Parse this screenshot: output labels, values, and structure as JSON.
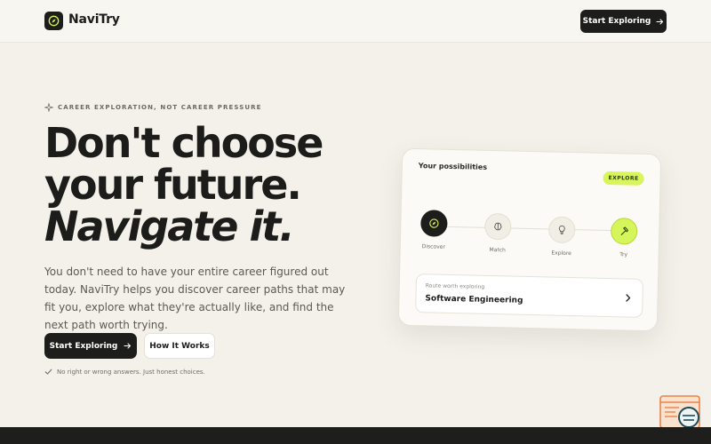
{
  "header": {
    "brand": "NaviTry",
    "cta_label": "Start Exploring"
  },
  "hero": {
    "eyebrow": "CAREER EXPLORATION, NOT CAREER PRESSURE",
    "headline_line1": "Don't choose",
    "headline_line2": "your future.",
    "headline_line3": "Navigate it.",
    "intro": "You don't need to have your entire career figured out today. NaviTry helps you discover career paths that may fit you, explore what they're actually like, and find the next path worth trying.",
    "primary_label": "Start Exploring",
    "secondary_label": "How It Works",
    "note": "No right or wrong answers. Just honest choices."
  },
  "card": {
    "title": "Your possibilities",
    "badge": "EXPLORE",
    "steps": [
      {
        "label": "Discover",
        "icon": "compass-icon"
      },
      {
        "label": "Match",
        "icon": "brain-icon"
      },
      {
        "label": "Explore",
        "icon": "lightbulb-icon"
      },
      {
        "label": "Try",
        "icon": "hammer-icon"
      }
    ],
    "route_kicker": "Route worth exploring",
    "route_value": "Software Engineering"
  },
  "colors": {
    "accent": "#d8f55a",
    "dark": "#1d1d1b",
    "background": "#f4f1ea"
  }
}
